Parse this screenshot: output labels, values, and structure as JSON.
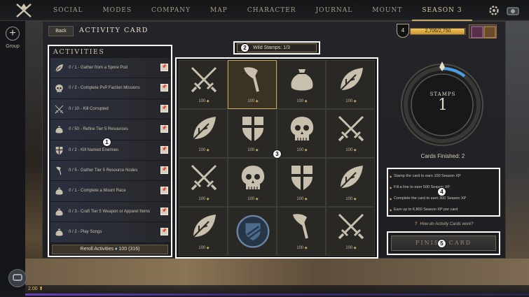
{
  "nav": {
    "items": [
      "SOCIAL",
      "MODES",
      "COMPANY",
      "MAP",
      "CHARACTER",
      "JOURNAL",
      "MOUNT",
      "SEASON 3"
    ],
    "active_index": 7
  },
  "rail": {
    "group_label": "Group"
  },
  "header": {
    "back_label": "Back",
    "title": "ACTIVITY CARD",
    "season_level": "4",
    "xp_text": "2,706/2,750",
    "xp_fraction": 0.984
  },
  "activities": {
    "header": "ACTIVITIES",
    "items": [
      {
        "icon": "leaf-icon",
        "text": "0 / 1 - Gather from a Spore Pod"
      },
      {
        "icon": "skull-icon",
        "text": "0 / 2 - Complete PvP Faction Missions"
      },
      {
        "icon": "crossed-swords-icon",
        "text": "0 / 10 - Kill Corrupted"
      },
      {
        "icon": "bag-icon",
        "text": "0 / 50 - Refine Tier 5 Resources"
      },
      {
        "icon": "shield-icon",
        "text": "0 / 2 - Kill Named Enemies"
      },
      {
        "icon": "axe-icon",
        "text": "0 / 5 - Gather Tier 5 Resource Nodes"
      },
      {
        "icon": "bag-icon",
        "text": "0 / 1 - Complete a Mount Race"
      },
      {
        "icon": "bag-icon",
        "text": "0 / 3 - Craft Tier 5 Weapon or Apparel Items"
      },
      {
        "icon": "bag-icon",
        "text": "0 / 2 - Play Songs"
      }
    ],
    "reroll_label": "Reroll Activities",
    "reroll_cost": "100 (316)"
  },
  "wild_stamps": {
    "text": "Wild Stamps: 1/3"
  },
  "grid": {
    "cells": [
      {
        "symbol": "swords",
        "value": "100"
      },
      {
        "symbol": "axe",
        "value": "100",
        "highlight": true
      },
      {
        "symbol": "bag",
        "value": "100"
      },
      {
        "symbol": "leaf",
        "value": "100"
      },
      {
        "symbol": "leaf",
        "value": "100"
      },
      {
        "symbol": "shield",
        "value": "100"
      },
      {
        "symbol": "skull",
        "value": "100"
      },
      {
        "symbol": "swords",
        "value": "100"
      },
      {
        "symbol": "swords",
        "value": "100"
      },
      {
        "symbol": "skull",
        "value": "100"
      },
      {
        "symbol": "shield",
        "value": "100"
      },
      {
        "symbol": "leaf",
        "value": "100"
      },
      {
        "symbol": "leaf",
        "value": "100"
      },
      {
        "symbol": "stamp",
        "value": ""
      },
      {
        "symbol": "axe",
        "value": "100"
      },
      {
        "symbol": "swords",
        "value": "100"
      }
    ]
  },
  "stamps": {
    "label": "STAMPS",
    "count": "1",
    "cards_finished": "Cards Finished: 2"
  },
  "rules": [
    "Stamp the card to earn 100 Season XP",
    "Fill a line to earn 500 Season XP",
    "Complete the card to earn 300 Season XP",
    "Earn up to 6,800 Season XP per card"
  ],
  "help_text": "How do Activity Cards work?",
  "finish_label": "FINISH CARD",
  "markers": [
    "1",
    "2",
    "3",
    "4",
    "5"
  ],
  "footer": {
    "level": "2.00"
  },
  "colors": {
    "accent": "#c9a55a",
    "xp": "#f1c453",
    "gem": "#7ad0ff"
  }
}
